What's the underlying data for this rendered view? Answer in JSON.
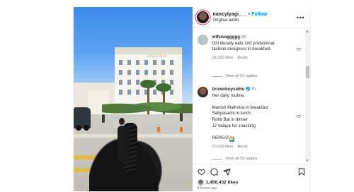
{
  "post": {
    "header": {
      "username": "nancytyagi___",
      "separator": "•",
      "follow_label": "Follow",
      "subtitle": "Original audio",
      "more_label": "•••"
    },
    "photo": {
      "hotel_sign": "SPLENDID"
    },
    "comments": [
      {
        "username": "wtfswaggggg",
        "time": "8h",
        "lines": [
          "Girl literally eats 100 profesional",
          "fashion designers in breakfast"
        ],
        "likes": "32,291 likes",
        "reply_label": "Reply",
        "view_replies": "View all 52 replies",
        "avatar_color": "#b9c3c8"
      },
      {
        "username": "brownboysidhu",
        "verified": true,
        "time": "7h",
        "lines": [
          "Her daily routine:",
          "",
          "Manish Malhotra in breakfast",
          "Sabyasachi in lunch",
          "Rohit Bal in dinner",
          "JJ Valaya for snacking",
          "",
          "REPEAT"
        ],
        "repeat_emoji": "🔁",
        "likes": "23,029 likes",
        "reply_label": "Reply",
        "view_replies": "View all 55 replies",
        "avatar_color": "#5a4038"
      }
    ],
    "actions": {
      "like_icon": "heart-icon",
      "comment_icon": "comment-icon",
      "share_icon": "share-icon",
      "save_icon": "bookmark-icon"
    },
    "likes_count": "1,456,432 likes",
    "time_ago": "8 hours ago"
  },
  "colors": {
    "accent": "#0095f6",
    "text": "#262626",
    "muted": "#737373"
  }
}
